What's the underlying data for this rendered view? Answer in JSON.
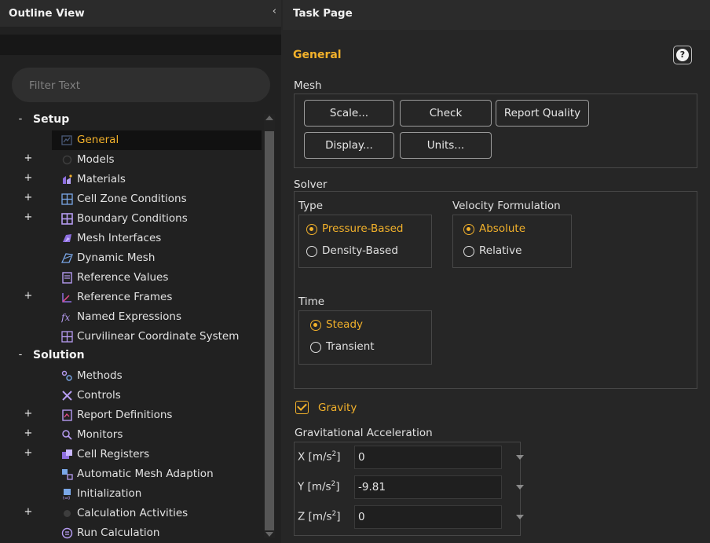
{
  "outline": {
    "title": "Outline View",
    "collapse_glyph": "‹",
    "filter_placeholder": "Filter Text",
    "tree": [
      {
        "label": "Setup",
        "section": true,
        "expander": "-"
      },
      {
        "label": "General",
        "icon": "general-icon",
        "selected": true
      },
      {
        "label": "Models",
        "icon": "models-icon",
        "expander": "+"
      },
      {
        "label": "Materials",
        "icon": "materials-icon",
        "expander": "+"
      },
      {
        "label": "Cell Zone Conditions",
        "icon": "cell-zone-conditions-icon",
        "expander": "+"
      },
      {
        "label": "Boundary Conditions",
        "icon": "boundary-conditions-icon",
        "expander": "+"
      },
      {
        "label": "Mesh Interfaces",
        "icon": "mesh-interfaces-icon"
      },
      {
        "label": "Dynamic Mesh",
        "icon": "dynamic-mesh-icon"
      },
      {
        "label": "Reference Values",
        "icon": "reference-values-icon"
      },
      {
        "label": "Reference Frames",
        "icon": "reference-frames-icon",
        "expander": "+"
      },
      {
        "label": "Named Expressions",
        "icon": "named-expressions-icon"
      },
      {
        "label": "Curvilinear Coordinate System",
        "icon": "curvilinear-coordinate-system-icon"
      },
      {
        "label": "Solution",
        "section": true,
        "expander": "-"
      },
      {
        "label": "Methods",
        "icon": "methods-icon"
      },
      {
        "label": "Controls",
        "icon": "controls-icon"
      },
      {
        "label": "Report Definitions",
        "icon": "report-definitions-icon",
        "expander": "+"
      },
      {
        "label": "Monitors",
        "icon": "monitors-icon",
        "expander": "+"
      },
      {
        "label": "Cell Registers",
        "icon": "cell-registers-icon",
        "expander": "+"
      },
      {
        "label": "Automatic Mesh Adaption",
        "icon": "automatic-mesh-adaption-icon"
      },
      {
        "label": "Initialization",
        "icon": "initialization-icon"
      },
      {
        "label": "Calculation Activities",
        "icon": "calculation-activities-icon",
        "expander": "+"
      },
      {
        "label": "Run Calculation",
        "icon": "run-calculation-icon"
      }
    ]
  },
  "task": {
    "title": "Task Page",
    "page_title": "General",
    "help_glyph": "?",
    "mesh": {
      "label": "Mesh",
      "buttons": {
        "scale": "Scale...",
        "check": "Check",
        "report_quality": "Report Quality",
        "display": "Display...",
        "units": "Units..."
      }
    },
    "solver": {
      "label": "Solver",
      "type": {
        "label": "Type",
        "options": [
          {
            "label": "Pressure-Based",
            "selected": true
          },
          {
            "label": "Density-Based",
            "selected": false
          }
        ]
      },
      "velocity": {
        "label": "Velocity Formulation",
        "options": [
          {
            "label": "Absolute",
            "selected": true
          },
          {
            "label": "Relative",
            "selected": false
          }
        ]
      },
      "time": {
        "label": "Time",
        "options": [
          {
            "label": "Steady",
            "selected": true
          },
          {
            "label": "Transient",
            "selected": false
          }
        ]
      }
    },
    "gravity": {
      "label": "Gravity",
      "checked": true
    },
    "acceleration": {
      "label": "Gravitational Acceleration",
      "unit_prefix": "[m/s",
      "unit_power": "2",
      "unit_suffix": "]",
      "rows": [
        {
          "axis": "X",
          "value": "0"
        },
        {
          "axis": "Y",
          "value": "-9.81"
        },
        {
          "axis": "Z",
          "value": "0"
        }
      ]
    }
  },
  "colors": {
    "accent": "#f2b12b",
    "panel_bg": "#262626",
    "tree_bg": "#212121",
    "header_bg": "#2b2b2b"
  }
}
